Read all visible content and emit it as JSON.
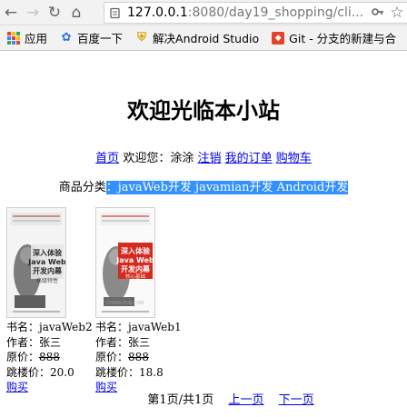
{
  "browser": {
    "url_host": "127.0.0.1",
    "url_path": ":8080/day19_shopping/cli..."
  },
  "bookmarks": [
    {
      "label": "应用",
      "icon": "apps-grid-icon"
    },
    {
      "label": "百度一下",
      "icon": "baidu-paw-icon"
    },
    {
      "label": "解决Android Studio",
      "icon": "shield-icon"
    },
    {
      "label": "Git - 分支的新建与合",
      "icon": "git-icon"
    }
  ],
  "page": {
    "title": "欢迎光临本小站",
    "home_link": "首页",
    "welcome_text": "欢迎您：涂涂",
    "logout_link": "注销",
    "orders_link": "我的订单",
    "cart_link": "购物车",
    "category_label": "商品分类",
    "category_selected": "：javaWeb开发 javamian开发 Android开发"
  },
  "books": [
    {
      "name_label": "书名：javaWeb2",
      "author_label": "作者：张三",
      "price_prefix": "原价：",
      "price_value": "888",
      "sale_label": "跳楼价：20.0",
      "buy_link": "购买",
      "cover_title": "深入体验 Java Web 开发内幕",
      "cover_subtitle": "高级特性"
    },
    {
      "name_label": "书名：javaWeb1",
      "author_label": "作者：张三",
      "price_prefix": "原价：",
      "price_value": "888",
      "sale_label": "跳楼价：18.8",
      "buy_link": "购买",
      "cover_title": "深入体验 Java Web 开发内幕",
      "cover_subtitle": "核心基础"
    }
  ],
  "pager": {
    "info": "第1页/共1页",
    "prev": "上一页",
    "next": "下一页"
  },
  "colors": {
    "selection": "#3390ff",
    "link": "#0000ee"
  }
}
